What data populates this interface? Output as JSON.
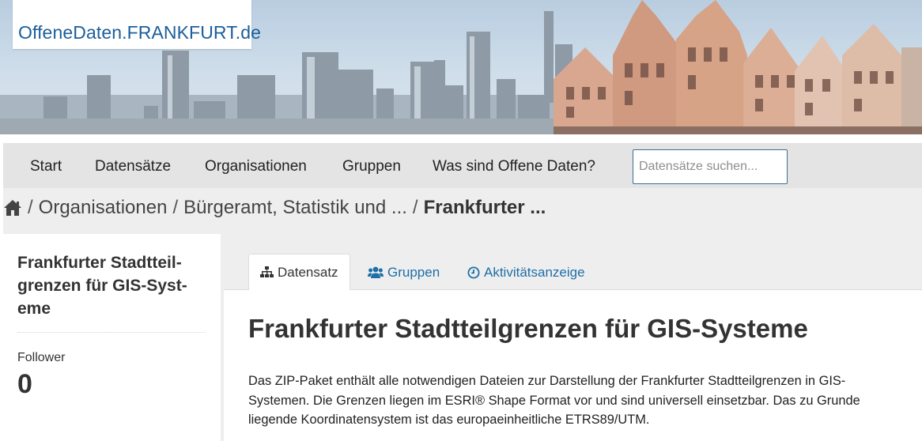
{
  "site": {
    "logo_text": "OffeneDaten.FRANKFURT.de"
  },
  "nav": {
    "items": [
      "Start",
      "Datensätze",
      "Organisationen",
      "Gruppen",
      "Was sind Offene Daten?"
    ],
    "search_placeholder": "Datensätze suchen..."
  },
  "breadcrumb": {
    "home_icon": "home-icon",
    "separator": "/",
    "items": [
      "Organisationen",
      "Bürgeramt, Statistik und ...",
      "Frankfurter ..."
    ]
  },
  "sidebar": {
    "title": "Frankfurter Stadtteil­grenzen für GIS-Syst­eme",
    "follower_label": "Follower",
    "follower_count": "0"
  },
  "tabs": [
    {
      "label": "Datensatz",
      "icon": "sitemap-icon",
      "active": true
    },
    {
      "label": "Gruppen",
      "icon": "users-icon",
      "active": false
    },
    {
      "label": "Aktivitätsanzeige",
      "icon": "clock-icon",
      "active": false
    }
  ],
  "dataset": {
    "title": "Frankfurter Stadtteilgrenzen für GIS-Systeme",
    "description": "Das ZIP-Paket enthält alle notwendigen Dateien zur Darstellung der Frankfurter Stadtteilgrenzen in GIS-Systemen. Die Grenzen liegen im ESRI® Shape Format vor und sind universell einsetzbar. Das zu Grunde liegende Koordinatensystem ist das europaeinheitliche ETRS89/UTM."
  },
  "colors": {
    "link": "#1e6fa8",
    "logo": "#1b5e9a",
    "nav_bg": "#e4e4e4",
    "search_border": "#3c6e91"
  }
}
